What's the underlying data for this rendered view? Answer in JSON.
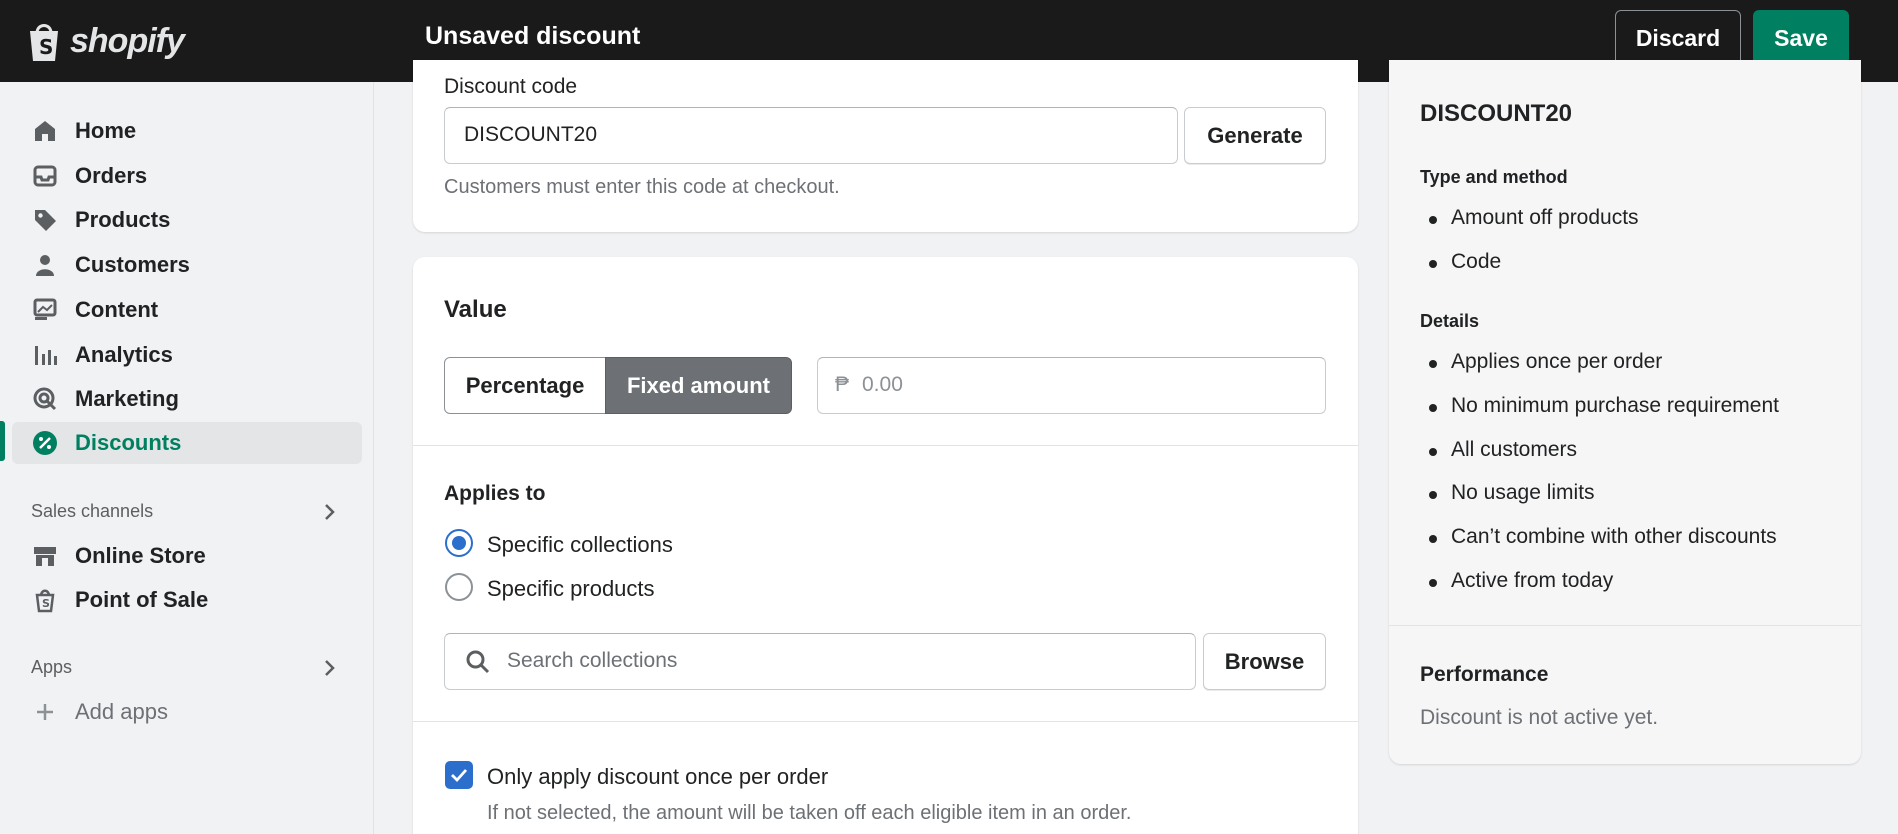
{
  "topbar": {
    "brand": "shopify",
    "page_title": "Unsaved discount",
    "discard_label": "Discard",
    "save_label": "Save"
  },
  "sidebar": {
    "items": [
      {
        "label": "Home",
        "icon": "home-icon"
      },
      {
        "label": "Orders",
        "icon": "inbox-icon"
      },
      {
        "label": "Products",
        "icon": "tag-icon"
      },
      {
        "label": "Customers",
        "icon": "person-icon"
      },
      {
        "label": "Content",
        "icon": "image-icon"
      },
      {
        "label": "Analytics",
        "icon": "bar-chart-icon"
      },
      {
        "label": "Marketing",
        "icon": "target-icon"
      },
      {
        "label": "Discounts",
        "icon": "discount-icon"
      }
    ],
    "active_item": "Discounts",
    "sales_channels_label": "Sales channels",
    "channels": [
      {
        "label": "Online Store",
        "icon": "store-icon"
      },
      {
        "label": "Point of Sale",
        "icon": "shopping-bag-icon"
      }
    ],
    "apps_label": "Apps",
    "add_apps_label": "Add apps"
  },
  "code_card": {
    "label": "Discount code",
    "value": "DISCOUNT20",
    "generate_label": "Generate",
    "helper": "Customers must enter this code at checkout."
  },
  "value_card": {
    "heading": "Value",
    "percentage_label": "Percentage",
    "fixed_label": "Fixed amount",
    "selected": "Fixed amount",
    "currency_symbol": "₱",
    "amount_placeholder": "0.00",
    "applies_heading": "Applies to",
    "options": [
      "Specific collections",
      "Specific products"
    ],
    "selected_option": "Specific collections",
    "search_placeholder": "Search collections",
    "browse_label": "Browse",
    "once_per_order_label": "Only apply discount once per order",
    "once_per_order_checked": true,
    "once_per_order_helper": "If not selected, the amount will be taken off each eligible item in an order."
  },
  "summary": {
    "title": "DISCOUNT20",
    "type_heading": "Type and method",
    "type_items": [
      "Amount off products",
      "Code"
    ],
    "details_heading": "Details",
    "details_items": [
      "Applies once per order",
      "No minimum purchase requirement",
      "All customers",
      "No usage limits",
      "Can’t combine with other discounts",
      "Active from today"
    ],
    "performance_heading": "Performance",
    "performance_text": "Discount is not active yet."
  },
  "colors": {
    "accent_green": "#008060",
    "topbar_bg": "#1a1a1a",
    "selected_blue": "#2c6ecb"
  }
}
